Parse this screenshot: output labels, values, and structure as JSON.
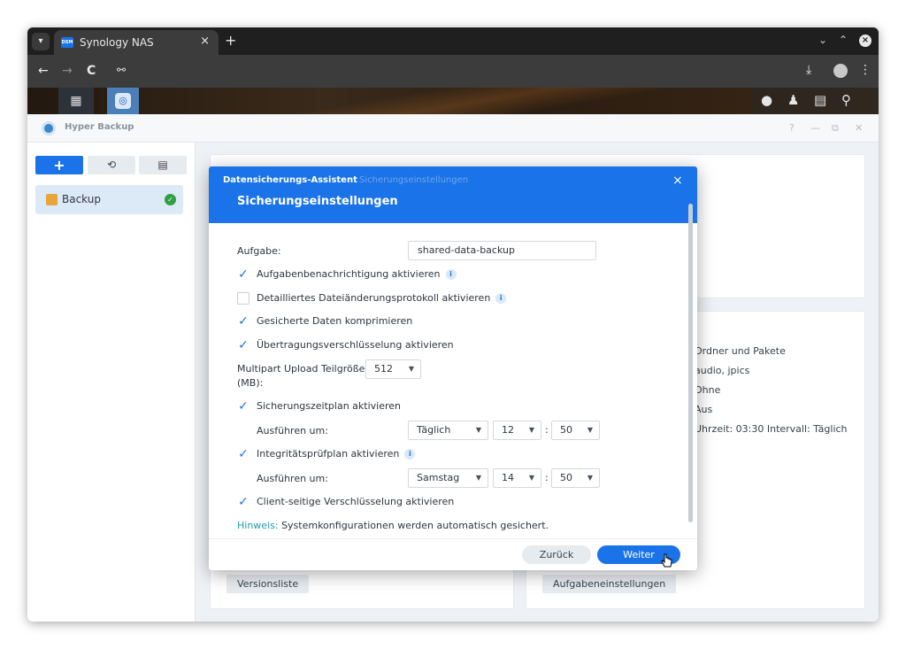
{
  "browser": {
    "tab_title": "Synology NAS",
    "tab_favicon_text": "DSM",
    "tab_close": "×",
    "new_tab": "+",
    "back": "←",
    "forward": "→",
    "reload": "C",
    "site_info": "⚯",
    "download": "⤓",
    "menu": "⋮",
    "minimize": "⌄",
    "maximize": "⌃",
    "close": "×"
  },
  "dsm": {
    "main_menu_icon": "grid-icon",
    "app_icon": "hyper-backup-icon",
    "tray": [
      "chat-notification-icon",
      "user-icon",
      "widgets-icon",
      "search-icon"
    ]
  },
  "app": {
    "title": "Hyper Backup",
    "controls": [
      "?",
      "—",
      "⧉",
      "✕"
    ]
  },
  "sidebar": {
    "add_label": "+",
    "restore_label": "⟲",
    "log_label": "▤",
    "items": [
      {
        "label": "Backup",
        "status": "ok"
      }
    ]
  },
  "background": {
    "summary_lines": [
      "Ordner und Pakete",
      "audio, jpics",
      "Ohne",
      "Aus",
      "Uhrzeit: 03:30 Intervall: Täglich"
    ],
    "version_list_button": "Versionsliste",
    "task_settings_button": "Aufgabeneinstellungen"
  },
  "modal": {
    "breadcrumb_active": "Datensicherungs-Assistent",
    "breadcrumb_step": "Sicherungseinstellungen",
    "title": "Sicherungseinstellungen",
    "close": "×",
    "task_label": "Aufgabe:",
    "task_value": "shared-data-backup",
    "options": [
      {
        "label": "Aufgabenbenachrichtigung aktivieren",
        "checked": true,
        "info": true
      },
      {
        "label": "Detailliertes Dateiänderungsprotokoll aktivieren",
        "checked": false,
        "info": true
      },
      {
        "label": "Gesicherte Daten komprimieren",
        "checked": true,
        "info": false
      },
      {
        "label": "Übertragungsverschlüsselung aktivieren",
        "checked": true,
        "info": false
      }
    ],
    "multipart_label_1": "Multipart Upload Teilgröße",
    "multipart_label_2": "(MB):",
    "multipart_value": "512",
    "schedule_label": "Sicherungszeitplan aktivieren",
    "schedule_checked": true,
    "run_at_label": "Ausführen um:",
    "schedule_freq": "Täglich",
    "schedule_hour": "12",
    "schedule_min": "50",
    "integrity_label": "Integritätsprüfplan aktivieren",
    "integrity_checked": true,
    "integrity_run_at_label": "Ausführen um:",
    "integrity_freq": "Samstag",
    "integrity_hour": "14",
    "integrity_min": "50",
    "client_enc_label": "Client-seitige Verschlüsselung aktivieren",
    "client_enc_checked": true,
    "hint_prefix": "Hinweis:",
    "hint_text": "Systemkonfigurationen werden automatisch gesichert.",
    "back_button": "Zurück",
    "next_button": "Weiter"
  },
  "colors": {
    "accent": "#1a73e8",
    "success": "#2ea043",
    "hint": "#1f9bb0"
  }
}
